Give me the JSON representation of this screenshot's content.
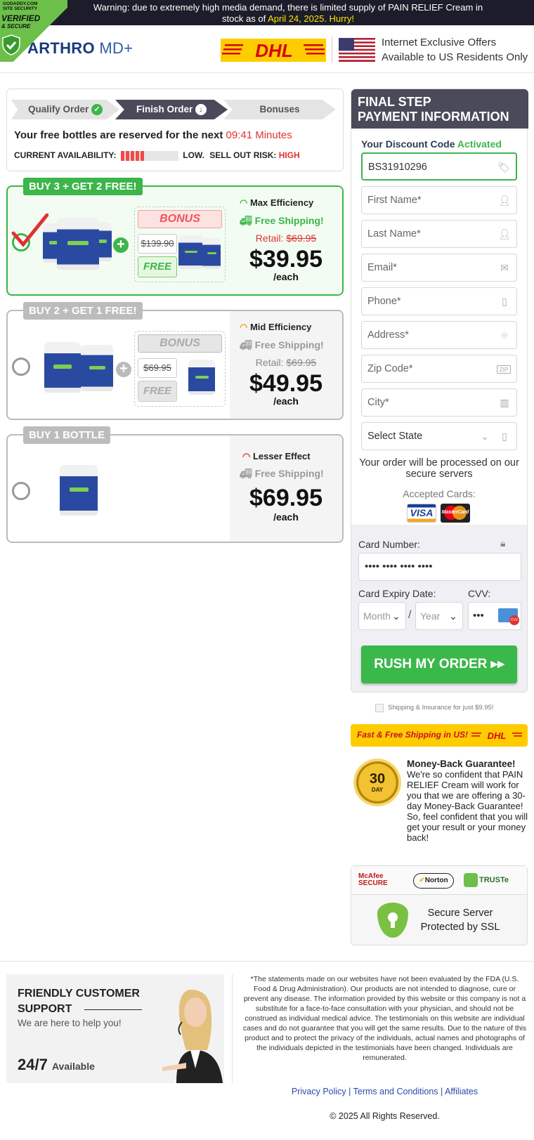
{
  "topbar": {
    "text_a": "Warning: due to extremely high media demand, there is limited supply of PAIN RELIEF Cream in",
    "text_b": "stock as of ",
    "date": "April 24, 2025. Hurry!"
  },
  "verified": {
    "line1": "GODADDY.COM",
    "line2": "SITE SECURITY",
    "line3": "VERIFIED",
    "line4": "& SECURE"
  },
  "header": {
    "brand": "ARTHRO",
    "brand_suffix": "MD+",
    "offer_line1": "Internet Exclusive Offers",
    "offer_line2": "Available to US Residents Only"
  },
  "steps": {
    "items": [
      {
        "label": "Qualify Order",
        "state": "done"
      },
      {
        "label": "Finish Order",
        "state": "current"
      },
      {
        "label": "Bonuses",
        "state": "pending"
      }
    ],
    "reserve_text": "Your free bottles are reserved for the next ",
    "timer": "09:41 Minutes",
    "availability_label": "CURRENT AVAILABILITY:",
    "availability_level": "LOW.",
    "risk_label": "SELL OUT RISK:",
    "risk_value": "HIGH",
    "availability_fill": 0.4
  },
  "offers": [
    {
      "badge": "BUY 3 + GET 2 FREE!",
      "efficiency": "Max Efficiency",
      "shipping": "Free Shipping!",
      "retail_label": "Retail: ",
      "retail": "$69.95",
      "price": "$39.95",
      "unit": "/each",
      "bonus": "BONUS",
      "old_price": "$139.90",
      "free": "FREE",
      "selected": true
    },
    {
      "badge": "BUY 2 + GET 1 FREE!",
      "efficiency": "Mid Efficiency",
      "shipping": "Free Shipping!",
      "retail_label": "Retail: ",
      "retail": "$69.95",
      "price": "$49.95",
      "unit": "/each",
      "bonus": "BONUS",
      "old_price": "$69.95",
      "free": "FREE",
      "selected": false
    },
    {
      "badge": "BUY 1 BOTTLE",
      "efficiency": "Lesser Effect",
      "shipping": "Free Shipping!",
      "price": "$69.95",
      "unit": "/each",
      "selected": false
    }
  ],
  "form": {
    "title_line1": "FINAL STEP",
    "title_line2": "PAYMENT INFORMATION",
    "discount_label": "Your Discount Code ",
    "discount_status": "Activated",
    "discount_code": "BS31910296",
    "first_name": "First Name*",
    "last_name": "Last Name*",
    "email": "Email*",
    "phone": "Phone*",
    "address": "Address*",
    "zip": "Zip Code*",
    "city": "City*",
    "state": "Select State",
    "secure_text": "Your order will be processed on our secure servers",
    "accepted_cards": "Accepted Cards:",
    "visa": "VISA",
    "mastercard": "MasterCard",
    "card_number_label": "Card Number:",
    "card_number": "•••• •••• •••• ••••",
    "expiry_label": "Card Expiry Date:",
    "month": "Month",
    "year": "Year",
    "cvv_label": "CVV:",
    "cvv": "•••",
    "cvv_icon_text": "CVV",
    "submit": "RUSH MY ORDER ▸▸"
  },
  "shipping_insurance": "Shipping & Insurance for just $9.95!",
  "dhl_bar": "Fast & Free Shipping in US!",
  "dhl_logo": "DHL",
  "guarantee": {
    "title": "Money-Back Guarantee!",
    "text": "We're so confident that PAIN RELIEF Cream will work for you that we are offering a 30-day Money-Back Guarantee! So, feel confident that you will get your result or your money back!",
    "seal_number": "30",
    "seal_word": "DAY"
  },
  "trust": {
    "mcafee": "McAfee SECURE",
    "norton": "Norton",
    "truste": "TRUSTe",
    "ssl_line1": "Secure Server",
    "ssl_line2": "Protected by SSL"
  },
  "footer": {
    "support_title_1": "FRIENDLY CUSTOMER",
    "support_title_2": "SUPPORT",
    "support_sub": "We are here to help you!",
    "support_hours": "24/7",
    "support_available": "Available",
    "disclaimer": "*The statements made on our websites have not been evaluated by the FDA (U.S. Food & Drug Administration). Our products are not intended to diagnose, cure or prevent any disease. The information provided by this website or this company is not a substitute for a face-to-face consultation with your physician, and should not be construed as individual medical advice. The testimonials on this website are individual cases and do not guarantee that you will get the same results. Due to the nature of this product and to protect the privacy of the individuals, actual names and photographs of the individuals depicted in the testimonials have been changed. Individuals are remunerated.",
    "links": [
      "Privacy Policy",
      "Terms and Conditions",
      "Affiliates"
    ],
    "copyright": "© 2025 All Rights Reserved."
  },
  "colors": {
    "green": "#3cb54a",
    "red": "#e0322f",
    "dark_header": "#4a4a5a",
    "dhl_yellow": "#ffcc00",
    "brand_blue": "#1a3a7c"
  }
}
